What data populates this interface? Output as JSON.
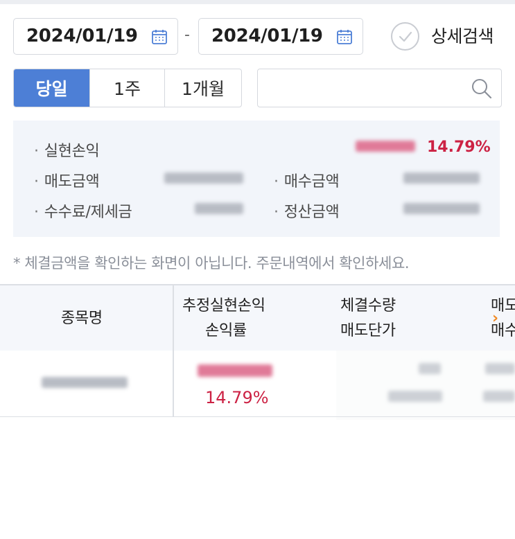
{
  "filter": {
    "start_date": "2024/01/19",
    "end_date": "2024/01/19",
    "separator": "-",
    "detail_search_label": "상세검색",
    "periods": [
      {
        "label": "당일",
        "active": true
      },
      {
        "label": "1주",
        "active": false
      },
      {
        "label": "1개월",
        "active": false
      }
    ],
    "search_value": "",
    "icons": {
      "calendar": "calendar-icon",
      "search": "search-icon",
      "check": "check-circle-icon"
    },
    "accent_color": "#4d7fd6"
  },
  "summary": {
    "realized_pl_label": "실현손익",
    "realized_rate": "14.79%",
    "sell_amount_label": "매도금액",
    "buy_amount_label": "매수금액",
    "fee_tax_label": "수수료/제세금",
    "settlement_label": "정산금액",
    "profit_color": "#cc2244"
  },
  "notice": "* 체결금액을 확인하는 화면이 아닙니다. 주문내역에서 확인하세요.",
  "table": {
    "headers": {
      "name": "종목명",
      "est_pl": "추정실현손익",
      "pl_rate": "손익률",
      "exec_qty": "체결수량",
      "sell_price": "매도단가",
      "col4_top": "매도",
      "col4_bottom": "매수"
    },
    "rows": [
      {
        "pl_rate": "14.79%"
      }
    ]
  }
}
